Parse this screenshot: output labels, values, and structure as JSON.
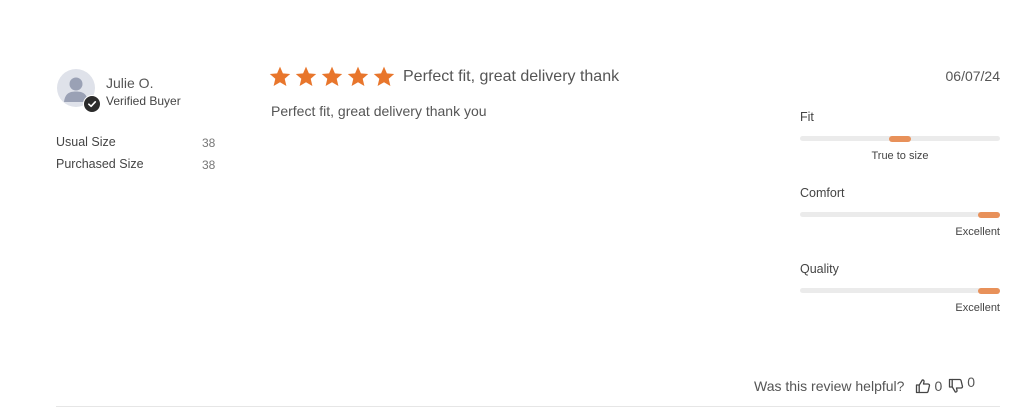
{
  "reviewer": {
    "name": "Julie O.",
    "status": "Verified Buyer",
    "avatar_icon": "user-silhouette-icon",
    "badge_icon": "checkmark-icon"
  },
  "attributes": [
    {
      "label": "Usual Size",
      "value": "38"
    },
    {
      "label": "Purchased Size",
      "value": "38"
    }
  ],
  "review": {
    "rating": 5,
    "max_rating": 5,
    "star_color": "#e8762c",
    "title": "Perfect fit, great delivery thank",
    "body": "Perfect fit, great delivery thank you",
    "date": "06/07/24"
  },
  "ratings": [
    {
      "label": "Fit",
      "value_label": "True to size",
      "level": 0.5,
      "align": "center"
    },
    {
      "label": "Comfort",
      "value_label": "Excellent",
      "level": 1.0,
      "align": "right"
    },
    {
      "label": "Quality",
      "value_label": "Excellent",
      "level": 1.0,
      "align": "right"
    }
  ],
  "rating_marker_color": "#e8915a",
  "helpful": {
    "prompt": "Was this review helpful?",
    "up_count": "0",
    "down_count": "0",
    "up_icon": "thumbs-up-icon",
    "down_icon": "thumbs-down-icon"
  }
}
